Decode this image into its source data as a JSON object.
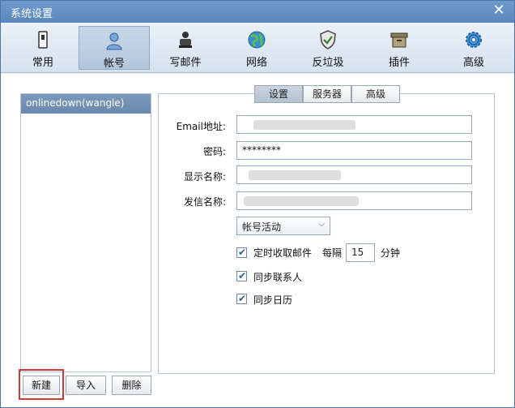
{
  "window": {
    "title": "系统设置"
  },
  "toolbar": {
    "items": [
      {
        "label": "常用"
      },
      {
        "label": "帐号"
      },
      {
        "label": "写邮件"
      },
      {
        "label": "网络"
      },
      {
        "label": "反垃圾"
      },
      {
        "label": "插件"
      },
      {
        "label": "高级"
      }
    ],
    "active": "帐号"
  },
  "accounts": {
    "items": [
      "onlinedown(wangle)"
    ],
    "buttons": {
      "new": "新建",
      "import": "导入",
      "delete": "删除"
    }
  },
  "tabs": [
    "设置",
    "服务器",
    "高级"
  ],
  "form": {
    "email_label": "Email地址:",
    "password_label": "密码:",
    "password_value": "********",
    "display_name_label": "显示名称:",
    "sender_name_label": "发信名称:",
    "status_select": "帐号活动",
    "timer_label": "定时收取邮件",
    "interval_prefix": "每隔",
    "interval_value": "15",
    "interval_unit": "分钟",
    "sync_contacts": "同步联系人",
    "sync_calendar": "同步日历"
  },
  "checks": {
    "timer": true,
    "contacts": true,
    "calendar": true
  },
  "colors": {
    "title_bg": "#5f8ec3",
    "highlight": "#d23a3a",
    "selected_item": "#6f8db2"
  }
}
